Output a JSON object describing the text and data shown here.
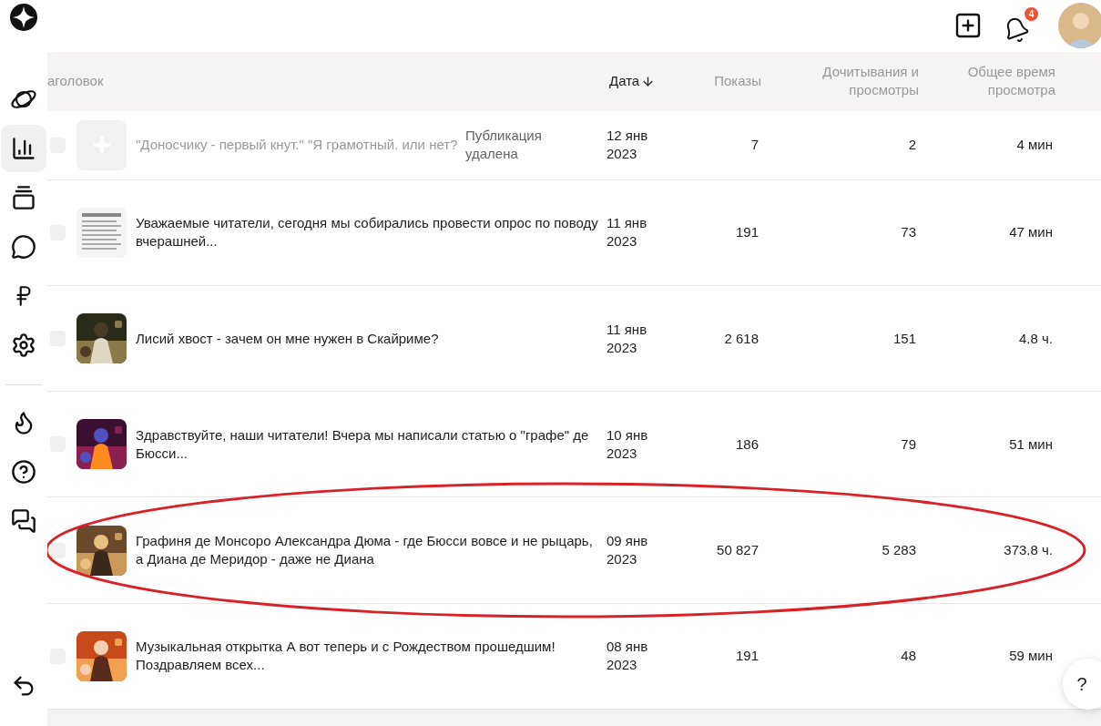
{
  "header": {
    "notifications": "4"
  },
  "sidebar": {
    "items": [
      {
        "selected": false
      },
      {
        "selected": true
      },
      {
        "selected": false
      },
      {
        "selected": false
      },
      {
        "selected": false
      },
      {
        "selected": false
      },
      {
        "selected": false
      },
      {
        "selected": false
      },
      {
        "selected": false
      }
    ]
  },
  "table": {
    "columns": [
      {
        "label": "аголовок",
        "sorted": false
      },
      {
        "label": "Дата",
        "sorted": true
      },
      {
        "label": "Показы",
        "sorted": false
      },
      {
        "label": "Дочитывания и просмотры",
        "sorted": false
      },
      {
        "label": "Общее время просмотра",
        "sorted": false
      }
    ],
    "rows": [
      {
        "checked": false,
        "thumbnail": {
          "kind": "placeholder"
        },
        "title": "\"Доносчику - первый кнут.\" \"Я грамотный. или нет?",
        "deleted": true,
        "status": "Публикация удалена",
        "date": "12 янв 2023",
        "shows": "7",
        "reads": "2",
        "time": "4 мин",
        "circled": false
      },
      {
        "checked": false,
        "thumbnail": {
          "kind": "document"
        },
        "title": "Уважаемые читатели, сегодня мы собирались провести опрос по поводу вчерашней...",
        "deleted": false,
        "date": "11 янв 2023",
        "shows": "191",
        "reads": "73",
        "time": "47 мин",
        "circled": false
      },
      {
        "checked": false,
        "title": "Лисий хвост - зачем он мне нужен в Скайриме?",
        "deleted": false,
        "date": "11 янв 2023",
        "shows": "2 618",
        "reads": "151",
        "time": "4.8 ч.",
        "circled": false
      },
      {
        "checked": false,
        "title": "Здравствуйте, наши читатели! Вчера мы написали статью о \"графе\" де Бюсси...",
        "deleted": false,
        "date": "10 янв 2023",
        "shows": "186",
        "reads": "79",
        "time": "51 мин",
        "circled": false
      },
      {
        "checked": false,
        "title": "Графиня де Монсоро Александра Дюма - где Бюсси вовсе и не рыцарь, а Диана де Меридор - даже не Диана",
        "deleted": false,
        "date": "09 янв 2023",
        "shows": "50 827",
        "reads": "5 283",
        "time": "373.8 ч.",
        "circled": true
      },
      {
        "checked": false,
        "title": "Музыкальная открытка А вот теперь и с Рождеством прошедшим! Поздравляем всех...",
        "deleted": false,
        "date": "08 янв 2023",
        "shows": "191",
        "reads": "48",
        "time": "59 мин",
        "circled": false
      }
    ]
  },
  "help_button": "?"
}
